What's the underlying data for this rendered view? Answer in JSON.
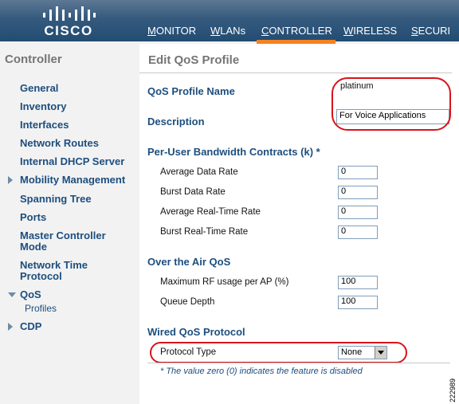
{
  "header": {
    "logo_text": "CISCO",
    "nav": [
      "MONITOR",
      "WLANs",
      "CONTROLLER",
      "WIRELESS",
      "SECURI"
    ],
    "active_color": "#f58220"
  },
  "sidebar": {
    "title": "Controller",
    "items": {
      "general": "General",
      "inventory": "Inventory",
      "interfaces": "Interfaces",
      "network_routes": "Network Routes",
      "dhcp": "Internal DHCP Server",
      "mobility": "Mobility Management",
      "spanning": "Spanning Tree",
      "ports": "Ports",
      "master_1": "Master Controller",
      "master_2": "Mode",
      "ntp_1": "Network Time",
      "ntp_2": "Protocol",
      "qos": "QoS",
      "profiles": "Profiles",
      "cdp": "CDP"
    }
  },
  "main": {
    "title": "Edit QoS Profile",
    "profile_name_label": "QoS Profile Name",
    "profile_name_value": "platinum",
    "description_label": "Description",
    "description_value": "For Voice Applications",
    "bw_section": "Per-User Bandwidth Contracts (k) *",
    "avg_data_label": "Average Data Rate",
    "avg_data_value": "0",
    "burst_data_label": "Burst Data Rate",
    "burst_data_value": "0",
    "avg_rt_label": "Average Real-Time Rate",
    "avg_rt_value": "0",
    "burst_rt_label": "Burst Real-Time Rate",
    "burst_rt_value": "0",
    "air_section": "Over the Air QoS",
    "rf_label": "Maximum RF usage per AP (%)",
    "rf_value": "100",
    "queue_label": "Queue Depth",
    "queue_value": "100",
    "wired_section": "Wired QoS Protocol",
    "protocol_label": "Protocol Type",
    "protocol_value": "None",
    "note": "* The value zero (0) indicates the feature is disabled"
  },
  "figure_number": "222989",
  "colors": {
    "highlight": "#d7141b",
    "link": "#1d4e7e"
  }
}
